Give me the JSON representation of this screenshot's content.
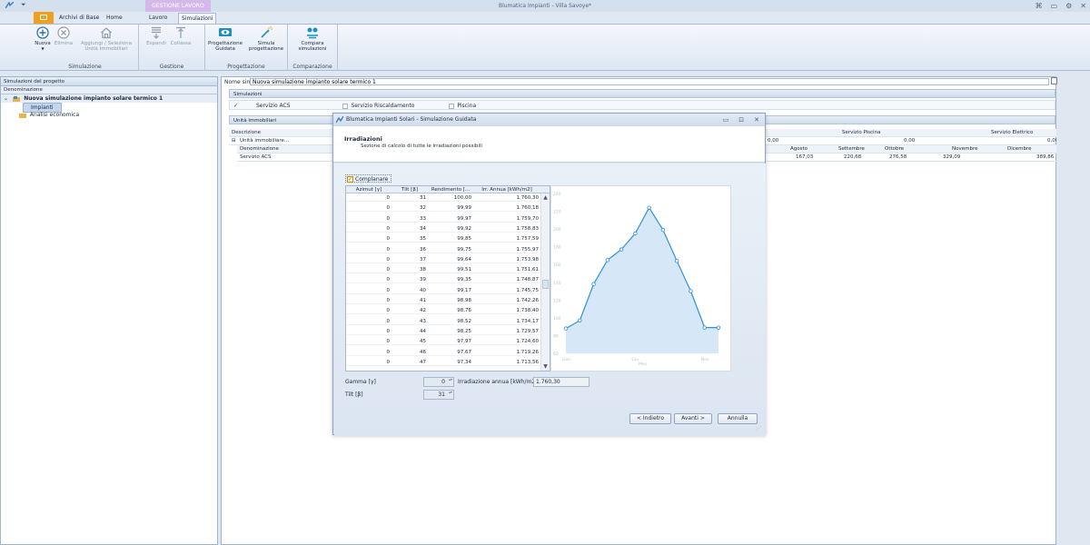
{
  "window": {
    "title": "Blumatica Impianti - Villa Savoye*",
    "context_group": "GESTIONE LAVORO"
  },
  "ribbon_tabs": [
    {
      "label": "Archivi di Base"
    },
    {
      "label": "Home"
    },
    {
      "label": "Lavoro"
    },
    {
      "label": "Simulazioni",
      "active": true
    }
  ],
  "ribbon_groups": {
    "simulazione": {
      "label": "Simulazione",
      "buttons": {
        "nuova": "Nuova",
        "elimina": "Elimina",
        "aggiungi_l1": "Aggiungi / Seleziona",
        "aggiungi_l2": "Unità Immobiliari"
      }
    },
    "gestione": {
      "label": "Gestione",
      "buttons": {
        "espandi": "Espandi",
        "collassa": "Collassa"
      }
    },
    "progettazione": {
      "label": "Progettazione",
      "buttons": {
        "guidata_l1": "Progettazione",
        "guidata_l2": "Guidata",
        "simula_l1": "Simula",
        "simula_l2": "progettazione"
      }
    },
    "comparazione": {
      "label": "Comparazione",
      "buttons": {
        "compara_l1": "Compara",
        "compara_l2": "simulazioni"
      }
    }
  },
  "left_pane": {
    "title": "Simulazioni del progetto",
    "column_header": "Denominazione",
    "tree": {
      "root": "Nuova simulazione impianto solare termico 1",
      "child_selected": "Impianti",
      "child2": "Analisi economica"
    }
  },
  "right_pane": {
    "nome_label": "Nome simulazione",
    "nome_value": "Nuova simulazione impianto solare termico 1",
    "simulazioni_header": "Simulazioni",
    "services": {
      "acs": "Servizio ACS",
      "riscaldamento": "Servizio Riscaldamento",
      "piscina": "Piscina"
    },
    "unita_header": "Unità immobiliari",
    "grid": {
      "descrizione_header": "Descrizione",
      "row1": "Unità immobiliare...",
      "denominazione_header": "Denominazione",
      "servizio_acs": "Servizio ACS",
      "servizio_piscina": "Servizio Piscina",
      "servizio_elettrico": "Servizio Elettrico",
      "zero1": "0,00",
      "zero2": "0,00",
      "zero3": "0,00",
      "months": [
        "Agosto",
        "Settembre",
        "Ottobre",
        "Novembre",
        "Dicembre"
      ],
      "month_values": [
        "167,03",
        "220,68",
        "276,58",
        "329,09",
        "389,86"
      ]
    }
  },
  "dialog": {
    "title": "Blumatica Impianti Solari - Simulazione Guidata",
    "heading": "Irradiazioni",
    "subheading": "Sezione di calcolo di tutte le irradiazioni possibili",
    "coplanare_label": "Complanare",
    "table_headers": [
      "Azimut [γ]",
      "Tilt [β]",
      "Rendimento [...",
      "Irr. Annua [kWh/m2]"
    ],
    "rows": [
      [
        "0",
        "31",
        "100,00",
        "1.760,30"
      ],
      [
        "0",
        "32",
        "99,99",
        "1.760,18"
      ],
      [
        "0",
        "33",
        "99,97",
        "1.759,70"
      ],
      [
        "0",
        "34",
        "99,92",
        "1.758,83"
      ],
      [
        "0",
        "35",
        "99,85",
        "1.757,59"
      ],
      [
        "0",
        "36",
        "99,75",
        "1.755,97"
      ],
      [
        "0",
        "37",
        "99,64",
        "1.753,98"
      ],
      [
        "0",
        "38",
        "99,51",
        "1.751,61"
      ],
      [
        "0",
        "39",
        "99,35",
        "1.748,87"
      ],
      [
        "0",
        "40",
        "99,17",
        "1.745,75"
      ],
      [
        "0",
        "41",
        "98,98",
        "1.742,26"
      ],
      [
        "0",
        "42",
        "98,76",
        "1.738,40"
      ],
      [
        "0",
        "43",
        "98,52",
        "1.734,17"
      ],
      [
        "0",
        "44",
        "98,25",
        "1.729,57"
      ],
      [
        "0",
        "45",
        "97,97",
        "1.724,60"
      ],
      [
        "0",
        "46",
        "97,67",
        "1.719,26"
      ],
      [
        "0",
        "47",
        "97,34",
        "1.713,56"
      ]
    ],
    "gamma_label": "Gamma [γ]",
    "gamma_value": "0",
    "tilt_label": "Tilt [β]",
    "tilt_value": "31",
    "irr_label": "Irradiazione annua [kWh/m2]",
    "irr_value": "1.760,30",
    "buttons": {
      "back": "< Indietro",
      "next": "Avanti >",
      "cancel": "Annulla"
    }
  },
  "chart_data": {
    "type": "area",
    "x": [
      "Gen",
      "Feb",
      "Mar",
      "Apr",
      "Mag",
      "Giu",
      "Lug",
      "Ago",
      "Set",
      "Ott",
      "Nov",
      "Dic"
    ],
    "x_tick_labels": [
      "Gen",
      "Giu",
      "Nov"
    ],
    "xlabel": "Mes",
    "ylim": [
      60,
      240
    ],
    "y_ticks": [
      60,
      80,
      100,
      120,
      140,
      160,
      180,
      200,
      220,
      240
    ],
    "series": [
      {
        "values": [
          88,
          97,
          138,
          165,
          177,
          195,
          224,
          199,
          164,
          130,
          89,
          89
        ]
      }
    ],
    "color": "#2f8fd8",
    "fill": "#d6e8f8",
    "grid": false
  }
}
